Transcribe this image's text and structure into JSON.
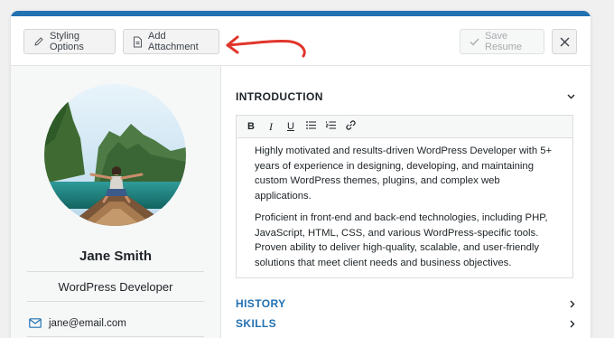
{
  "toolbar": {
    "styling_label": "Styling Options",
    "attach_label": "Add Attachment",
    "save_label": "Save Resume"
  },
  "profile": {
    "name": "Jane Smith",
    "job_title": "WordPress Developer",
    "email": "jane@email.com"
  },
  "sections": {
    "intro": {
      "heading": "INTRODUCTION",
      "paragraphs": [
        "Highly motivated and results-driven WordPress Developer with 5+ years of experience in designing, developing, and maintaining custom WordPress themes, plugins, and complex web applications.",
        "Proficient in front-end and back-end technologies, including PHP, JavaScript, HTML, CSS, and various WordPress-specific tools. Proven ability to deliver high-quality, scalable, and user-friendly solutions that meet client needs and business objectives."
      ]
    },
    "history": {
      "heading": "HISTORY"
    },
    "skills": {
      "heading": "SKILLS"
    }
  },
  "editor_toolbar": {
    "bold": "B",
    "italic": "I",
    "underline": "U"
  },
  "colors": {
    "accent": "#2271b1",
    "annotation_arrow": "#e0362c"
  }
}
